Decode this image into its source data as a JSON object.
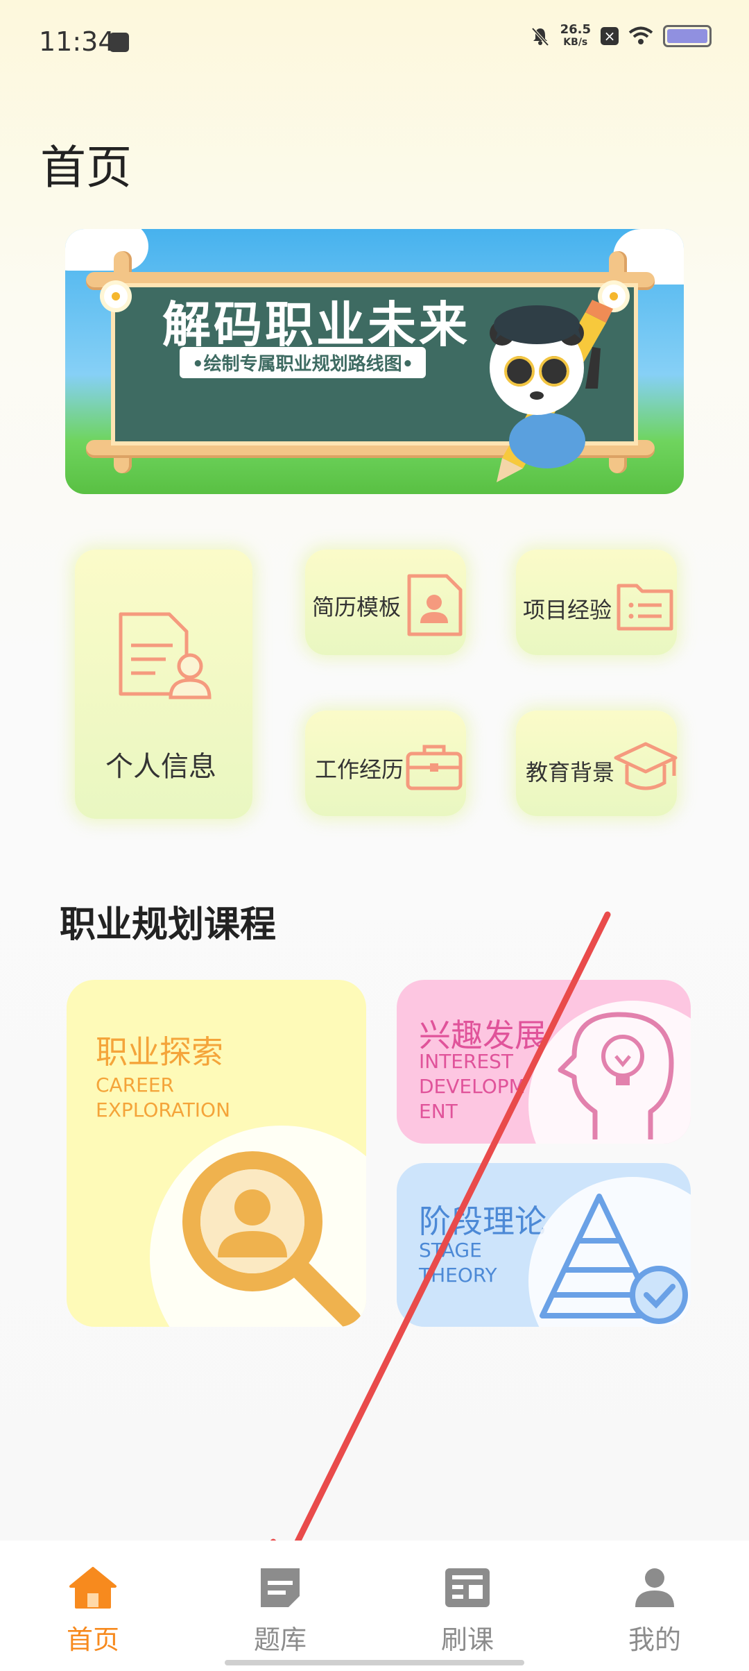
{
  "status": {
    "time": "11:34",
    "net_speed_value": "26.5",
    "net_speed_unit": "KB/s"
  },
  "page": {
    "title": "首页"
  },
  "banner": {
    "title": "解码职业未来",
    "subtitle": "•绘制专属职业规划路线图•"
  },
  "grid": {
    "personal_info": "个人信息",
    "resume_template": "简历模板",
    "project_experience": "项目经验",
    "work_experience": "工作经历",
    "education": "教育背景"
  },
  "section": {
    "title": "职业规划课程"
  },
  "courses": {
    "career": {
      "cn": "职业探索",
      "en1": "CAREER",
      "en2": "EXPLORATION"
    },
    "interest": {
      "cn": "兴趣发展",
      "en1": "INTEREST",
      "en2": "DEVELOPM",
      "en3": "ENT"
    },
    "stage": {
      "cn": "阶段理论",
      "en1": "STAGE",
      "en2": "THEORY"
    }
  },
  "nav": {
    "items": [
      {
        "label": "首页",
        "icon": "home-icon",
        "active": true
      },
      {
        "label": "题库",
        "icon": "question-bank-icon",
        "active": false
      },
      {
        "label": "刷课",
        "icon": "courses-icon",
        "active": false
      },
      {
        "label": "我的",
        "icon": "profile-icon",
        "active": false
      }
    ]
  },
  "colors": {
    "accent": "#f78a1e",
    "inactive": "#8c8c8c",
    "annotation_arrow": "#e94b4b"
  }
}
